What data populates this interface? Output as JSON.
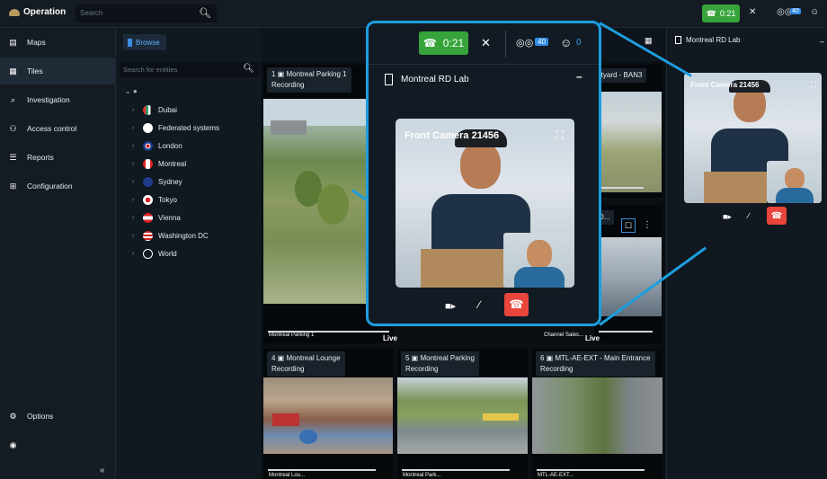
{
  "topbar": {
    "app_title": "Operation",
    "search_placeholder": "Search",
    "call_timer": "0:21",
    "incidents_count": "40",
    "visitors_count": "0"
  },
  "sidebar": {
    "items": [
      {
        "label": "Maps",
        "icon": "map-icon"
      },
      {
        "label": "Tiles",
        "icon": "tiles-icon"
      },
      {
        "label": "Investigation",
        "icon": "investigation-icon"
      },
      {
        "label": "Access control",
        "icon": "access-control-icon"
      },
      {
        "label": "Reports",
        "icon": "reports-icon"
      },
      {
        "label": "Configuration",
        "icon": "configuration-icon"
      }
    ],
    "options_label": "Options"
  },
  "browse": {
    "tab_label": "Browse",
    "search_placeholder": "Search for entities",
    "tree": [
      "Dubai",
      "Federated systems",
      "London",
      "Montreal",
      "Sydney",
      "Tokyo",
      "Vienna",
      "Washington DC",
      "World"
    ]
  },
  "tiles": [
    {
      "num": "1",
      "name": "Montreal Parking 1",
      "status": "Recording",
      "footer": "Montreal Parking 1"
    },
    {
      "num": "",
      "name": "rtyard - BAN3",
      "status": "",
      "footer": ""
    },
    {
      "num": "",
      "name": "D...",
      "status": "",
      "footer": "Channel Sales..."
    },
    {
      "num": "4",
      "name": "Montreal Lounge",
      "status": "Recording",
      "footer": "Montreal Lou..."
    },
    {
      "num": "5",
      "name": "Montreal Parking",
      "status": "Recording",
      "footer": "Montreal Park..."
    },
    {
      "num": "6",
      "name": "MTL-AE-EXT - Main Entrance",
      "status": "Recording",
      "footer": "MTL-AE-EXT..."
    }
  ],
  "live_label": "Live",
  "callout": {
    "timer": "0:21",
    "incidents_count": "40",
    "visitors_count": "0",
    "panel_title": "Montreal RD Lab",
    "camera_title": "Front Camera 21456"
  },
  "right_panel": {
    "title": "Montreal RD Lab",
    "camera_title": "Front Camera 21456"
  },
  "colors": {
    "accent": "#1d9ede",
    "call_green": "#36a43a",
    "end_call_red": "#e8453c",
    "badge_blue": "#2f8be6"
  }
}
